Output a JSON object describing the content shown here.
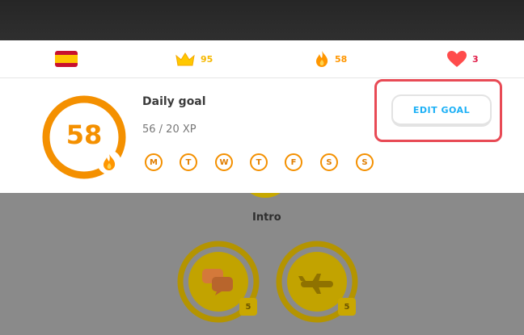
{
  "header": {
    "stats": [
      {
        "icon": "spanish-flag-icon",
        "value": ""
      },
      {
        "icon": "crown-icon",
        "value": "95",
        "color": "#f6b800"
      },
      {
        "icon": "flame-icon",
        "value": "58",
        "color": "#ff9600"
      },
      {
        "icon": "heart-icon",
        "value": "3",
        "color": "#e11d48"
      }
    ]
  },
  "daily_goal": {
    "streak": "58",
    "title": "Daily goal",
    "xp_text": "56 / 20 XP",
    "progress": 1.0,
    "days": [
      "M",
      "T",
      "W",
      "T",
      "F",
      "S",
      "S"
    ],
    "edit_label": "EDIT GOAL"
  },
  "course": {
    "unit_label": "Intro",
    "lessons": [
      {
        "icon": "chat-bubbles-icon",
        "level": "5"
      },
      {
        "icon": "airplane-icon",
        "level": "5"
      }
    ]
  },
  "colors": {
    "accent_orange": "#f49000",
    "accent_blue": "#1cb0f6",
    "highlight_red": "#e84a55"
  }
}
